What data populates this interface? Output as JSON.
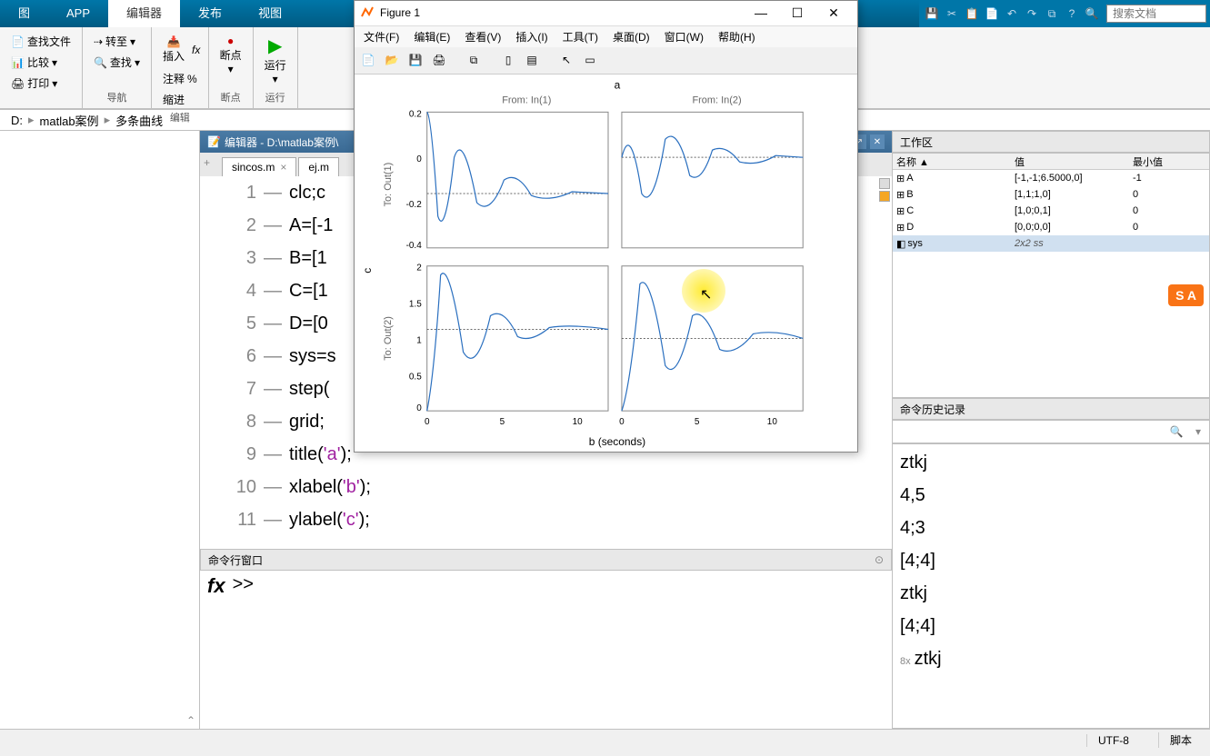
{
  "ribbon": {
    "tabs": [
      "图",
      "APP",
      "编辑器",
      "发布",
      "视图"
    ],
    "active_index": 2
  },
  "toolbar": {
    "find_files": "查找文件",
    "compare": "比较",
    "print": "打印",
    "nav_label": "导航",
    "goto": "转至",
    "find": "查找",
    "insert": "插入",
    "comment": "注释",
    "indent": "缩进",
    "edit_label": "编辑",
    "breakpoint": "断点",
    "bp_label": "断点",
    "run": "运行",
    "run_label": "运行"
  },
  "quick": {
    "search_placeholder": "搜索文档"
  },
  "breadcrumb": [
    "D:",
    "matlab案例",
    "多条曲线"
  ],
  "editor": {
    "title": "编辑器 - D:\\matlab案例\\",
    "tabs": [
      "sincos.m",
      "ej.m"
    ],
    "lines": [
      "clc;c",
      "A=[-1",
      "B=[1",
      "C=[1",
      "D=[0",
      "sys=s",
      "step(",
      "grid;",
      "title('a');",
      "xlabel('b');",
      "ylabel('c');"
    ]
  },
  "cmd": {
    "title": "命令行窗口",
    "prompt": ">>"
  },
  "workspace": {
    "title": "工作区",
    "columns": [
      "名称 ▲",
      "值",
      "最小值"
    ],
    "rows": [
      {
        "name": "A",
        "val": "[-1,-1;6.5000,0]",
        "min": "-1",
        "icon": "mat"
      },
      {
        "name": "B",
        "val": "[1,1;1,0]",
        "min": "0",
        "icon": "mat"
      },
      {
        "name": "C",
        "val": "[1,0;0,1]",
        "min": "0",
        "icon": "mat"
      },
      {
        "name": "D",
        "val": "[0,0;0,0]",
        "min": "0",
        "icon": "mat"
      },
      {
        "name": "sys",
        "val": "2x2 ss",
        "min": "",
        "icon": "obj",
        "sel": true
      }
    ],
    "sa_badge": "S A"
  },
  "history": {
    "title": "命令历史记录",
    "items": [
      "ztkj",
      "4,5",
      "4;3",
      "[4;4]",
      "ztkj",
      "[4;4]",
      "ztkj"
    ],
    "mult": "8x"
  },
  "status": {
    "encoding": "UTF-8",
    "script": "脚本"
  },
  "figure": {
    "title": "Figure 1",
    "menus": [
      "文件(F)",
      "编辑(E)",
      "查看(V)",
      "插入(I)",
      "工具(T)",
      "桌面(D)",
      "窗口(W)",
      "帮助(H)"
    ],
    "plot_title": "a",
    "xlabel": "b (seconds)",
    "ylabel": "c",
    "col_headers": [
      "From: In(1)",
      "From: In(2)"
    ],
    "row_headers": [
      "To: Out(1)",
      "To: Out(2)"
    ]
  },
  "chart_data": [
    {
      "type": "line",
      "title": "From: In(1) To: Out(1)",
      "xlim": [
        0,
        12
      ],
      "ylim": [
        -0.4,
        0.2
      ],
      "yticks": [
        -0.4,
        -0.2,
        0,
        0.2
      ]
    },
    {
      "type": "line",
      "title": "From: In(2) To: Out(1)",
      "xlim": [
        0,
        12
      ],
      "ylim": [
        -0.4,
        0.2
      ]
    },
    {
      "type": "line",
      "title": "From: In(1) To: Out(2)",
      "xlim": [
        0,
        12
      ],
      "ylim": [
        0,
        2
      ],
      "yticks": [
        0,
        0.5,
        1,
        1.5,
        2
      ],
      "xticks": [
        0,
        5,
        10
      ]
    },
    {
      "type": "line",
      "title": "From: In(2) To: Out(2)",
      "xlim": [
        0,
        12
      ],
      "ylim": [
        0,
        2
      ],
      "xticks": [
        0,
        5,
        10
      ]
    }
  ]
}
